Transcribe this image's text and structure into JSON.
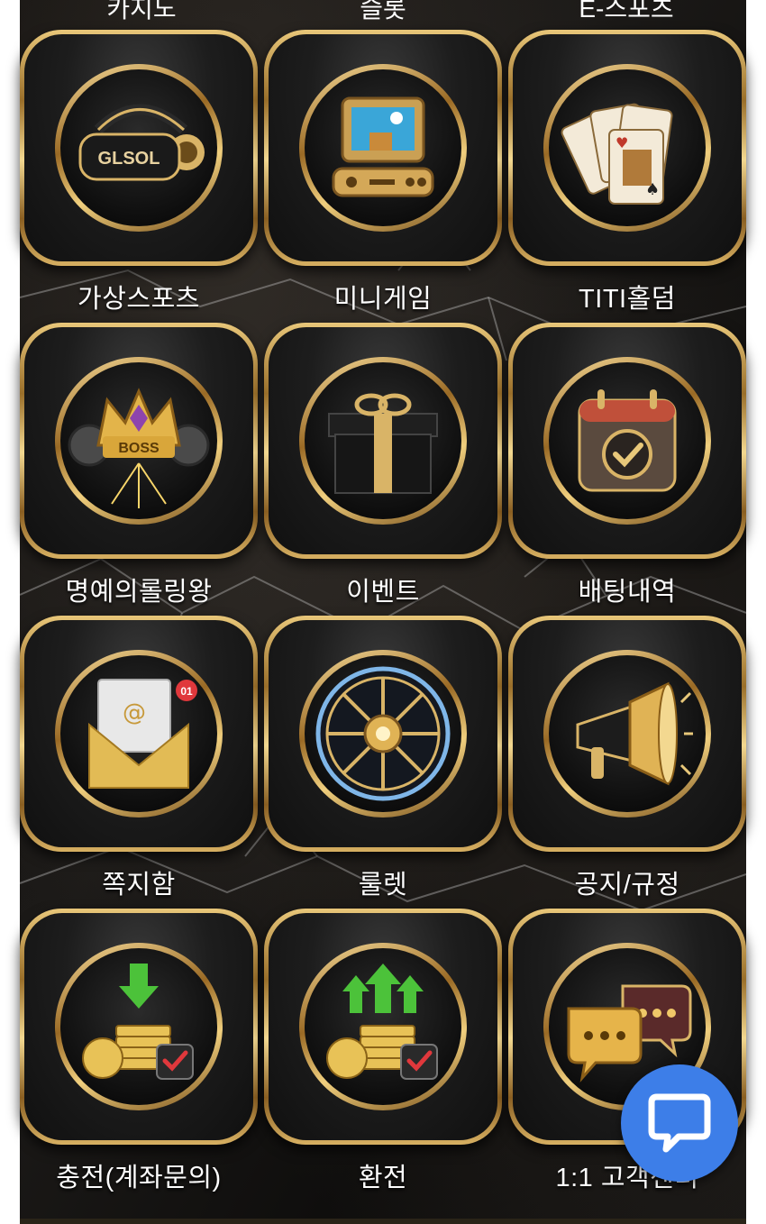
{
  "top_row_labels": [
    "카지노",
    "슬롯",
    "E-스포츠"
  ],
  "tiles": [
    {
      "label": "가상스포츠",
      "icon": "vr-headset-icon",
      "icon_text": "GLSOL"
    },
    {
      "label": "미니게임",
      "icon": "retro-computer-icon"
    },
    {
      "label": "TITI홀덤",
      "icon": "playing-cards-icon"
    },
    {
      "label": "명예의롤링왕",
      "icon": "boss-crown-icon",
      "icon_text": "BOSS"
    },
    {
      "label": "이벤트",
      "icon": "gift-box-icon"
    },
    {
      "label": "배팅내역",
      "icon": "calendar-check-icon"
    },
    {
      "label": "쪽지함",
      "icon": "mail-envelope-icon",
      "icon_text": "@",
      "badge": "01"
    },
    {
      "label": "룰렛",
      "icon": "roulette-wheel-icon"
    },
    {
      "label": "공지/규정",
      "icon": "megaphone-icon"
    },
    {
      "label": "충전(계좌문의)",
      "icon": "deposit-coins-icon"
    },
    {
      "label": "환전",
      "icon": "withdraw-coins-icon"
    },
    {
      "label": "1:1 고객센터",
      "icon": "chat-bubbles-icon"
    }
  ],
  "colors": {
    "gold": "#d9b467",
    "chat_button": "#3d7ee8",
    "arrow_green": "#4cc23a",
    "check_red": "#e0383c"
  },
  "chat_button_icon": "chat-icon"
}
